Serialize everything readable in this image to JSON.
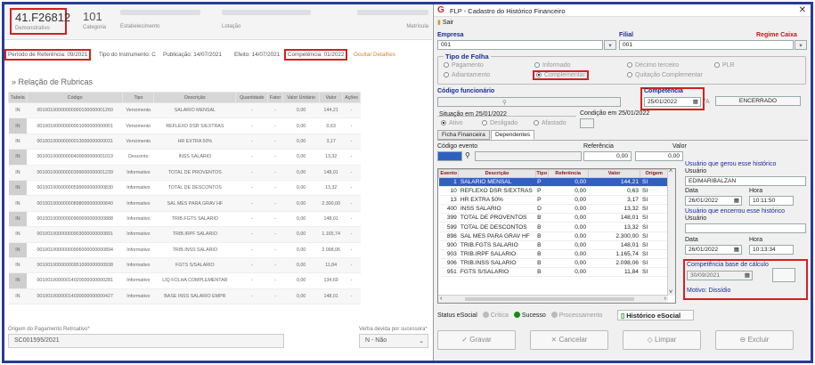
{
  "left": {
    "code": "41.F26812",
    "code_sub": "Demonstrativo",
    "count": "101",
    "count_sub": "Categoria",
    "estab_sub": "Estabelecimento",
    "lotacao_sub": "Lotação",
    "matricula_sub": "Matrícula",
    "periodo": "Período de Referência: 09/2021",
    "tipo_instr": "Tipo do Instrumento: C",
    "publicacao": "Publicação: 14/07/2021",
    "efeito": "Efeito: 14/07/2021",
    "competencia": "Competência: 01/2022",
    "ocultar": "Ocultar Detalhes",
    "section": "Relação de Rubricas",
    "columns": [
      "Tabela",
      "Código",
      "Tipo",
      "Descrição",
      "Quantidade",
      "Fator",
      "Valor Unitário",
      "Valor",
      "Ações"
    ],
    "rows": [
      [
        "IN",
        "00100100000000000100000001260",
        "Vencimento",
        "SALARIO MENSAL",
        "-",
        "-",
        "0,00",
        "144,21",
        "-"
      ],
      [
        "IN",
        "00100100000000001000000000001",
        "Vencimento",
        "REFLEXO DSR S/EXTRAS",
        "-",
        "-",
        "0,00",
        "0,63",
        "-"
      ],
      [
        "IN",
        "00100100000000013000000000031",
        "Vencimento",
        "HR EXTRA 50%",
        "-",
        "-",
        "0,00",
        "3,17",
        "-"
      ],
      [
        "IN",
        "00100100000000400000000001019",
        "Desconto",
        "INSS SALARIO",
        "-",
        "-",
        "0,00",
        "13,32",
        "-"
      ],
      [
        "IN",
        "00100100000000399000000001239",
        "Informativo",
        "TOTAL DE PROVENTOS",
        "-",
        "-",
        "0,00",
        "148,01",
        "-"
      ],
      [
        "IN",
        "00100100000000599000000000830",
        "Informativo",
        "TOTAL DE DESCONTOS",
        "-",
        "-",
        "0,00",
        "13,32",
        "-"
      ],
      [
        "IN",
        "00100100000000898000000000840",
        "Informativo",
        "SAL MES PARA GRAV HF",
        "-",
        "-",
        "0,00",
        "2.300,00",
        "-"
      ],
      [
        "IN",
        "00100100000000900000000000888",
        "Informativo",
        "TRIB.FGTS SALARIO",
        "-",
        "-",
        "0,00",
        "148,01",
        "-"
      ],
      [
        "IN",
        "00100100000000903000000000891",
        "Informativo",
        "TRIB.IRPF SALARIO",
        "-",
        "-",
        "0,00",
        "1.165,74",
        "-"
      ],
      [
        "IN",
        "00100100000000906000000000894",
        "Informativo",
        "TRIB.INSS SALARIO",
        "-",
        "-",
        "0,00",
        "2.098,06",
        "-"
      ],
      [
        "IN",
        "00100100000000951000000000938",
        "Informativo",
        "FGTS S/SALARIO",
        "-",
        "-",
        "0,00",
        "11,84",
        "-"
      ],
      [
        "IN",
        "00100100000014020000000000281",
        "Informativo",
        "LIQ FOLHA COMPLEMENTAR",
        "-",
        "-",
        "0,00",
        "134,69",
        "-"
      ],
      [
        "IN",
        "00100100000014030000000000427",
        "Informativo",
        "BASE INSS SALARIO EMPR",
        "-",
        "-",
        "0,00",
        "148,01",
        "-"
      ]
    ],
    "origem_label": "Origem do Pagamento Retroativo*",
    "origem_value": "SC001595/2021",
    "verba_label": "Verba devida por sucessora*",
    "verba_value": "N - Não"
  },
  "dlg": {
    "title": "FLP - Cadastro do Histórico Financeiro",
    "close": "✕",
    "sair": "Sair",
    "empresa_label": "Empresa",
    "empresa_value": "001",
    "filial_label": "Filial",
    "filial_value": "001",
    "regime_label": "Regime Caixa",
    "tipo_folha": "Tipo de Folha",
    "radios": [
      "Pagamento",
      "Informado",
      "Décimo terceiro",
      "PLR",
      "Adiantamento",
      "Complementar",
      "Quitação Complementar"
    ],
    "cod_func_label": "Código funcionário",
    "competencia_label": "Competência",
    "competencia_value": "25/01/2022",
    "encerrado": "ENCERRADO",
    "situacao_label": "Situação em 25/01/2022",
    "sit_radios": [
      "Ativo",
      "Desligado",
      "Afastado"
    ],
    "condicao_label": "Condição em 25/01/2022",
    "tab1": "Ficha Financeira",
    "tab2": "Dependentes",
    "cod_evento": "Código evento",
    "referencia": "Referência",
    "valor": "Valor",
    "ref_value": "0,00",
    "val_value": "0,00",
    "grid_cols": [
      "Evento",
      "Descrição",
      "Tipo",
      "Referência",
      "Valor",
      "Origem"
    ],
    "grid_rows": [
      [
        "1",
        "SALARIO MENSAL",
        "P",
        "0,00",
        "144,21",
        "SI"
      ],
      [
        "10",
        "REFLEXO DSR S/EXTRAS",
        "P",
        "0,00",
        "0,63",
        "SI"
      ],
      [
        "13",
        "HR EXTRA 50%",
        "P",
        "0,00",
        "3,17",
        "SI"
      ],
      [
        "400",
        "INSS SALARIO",
        "D",
        "0,00",
        "13,32",
        "SI"
      ],
      [
        "399",
        "TOTAL DE PROVENTOS",
        "B",
        "0,00",
        "148,01",
        "SI"
      ],
      [
        "599",
        "TOTAL DE DESCONTOS",
        "B",
        "0,00",
        "13,32",
        "SI"
      ],
      [
        "898",
        "SAL MES PARA GRAV HF",
        "B",
        "0,00",
        "2.300,00",
        "SI"
      ],
      [
        "900",
        "TRIB.FGTS SALARIO",
        "B",
        "0,00",
        "148,01",
        "SI"
      ],
      [
        "903",
        "TRIB.IRPF SALARIO",
        "B",
        "0,00",
        "1.165,74",
        "SI"
      ],
      [
        "906",
        "TRIB.INSS SALARIO",
        "B",
        "0,00",
        "2.098,06",
        "SI"
      ],
      [
        "951",
        "FGTS S/SALARIO",
        "B",
        "0,00",
        "11,84",
        "SI"
      ]
    ],
    "user_gerou_label": "Usuário que gerou esse histórico",
    "usuario": "Usuário",
    "user_gerou": "EDIMARIBALZAN",
    "data": "Data",
    "hora": "Hora",
    "data1": "26/01/2022",
    "hora1": "10:11:50",
    "user_encerrou_label": "Usuário que encerrou esse histórico",
    "data2": "26/01/2022",
    "hora2": "10:13:34",
    "comp_base_label": "Competência base de cálculo",
    "comp_base_value": "30/09/2021",
    "motivo": "Motivo: Dissídio",
    "status_label": "Status eSocial",
    "status_crit": "Crítica",
    "status_ok": "Sucesso",
    "status_proc": "Processamento",
    "hist_esocial": "Histórico eSocial",
    "btn_gravar": "Gravar",
    "btn_cancelar": "Cancelar",
    "btn_limpar": "Limpar",
    "btn_excluir": "Excluir"
  }
}
